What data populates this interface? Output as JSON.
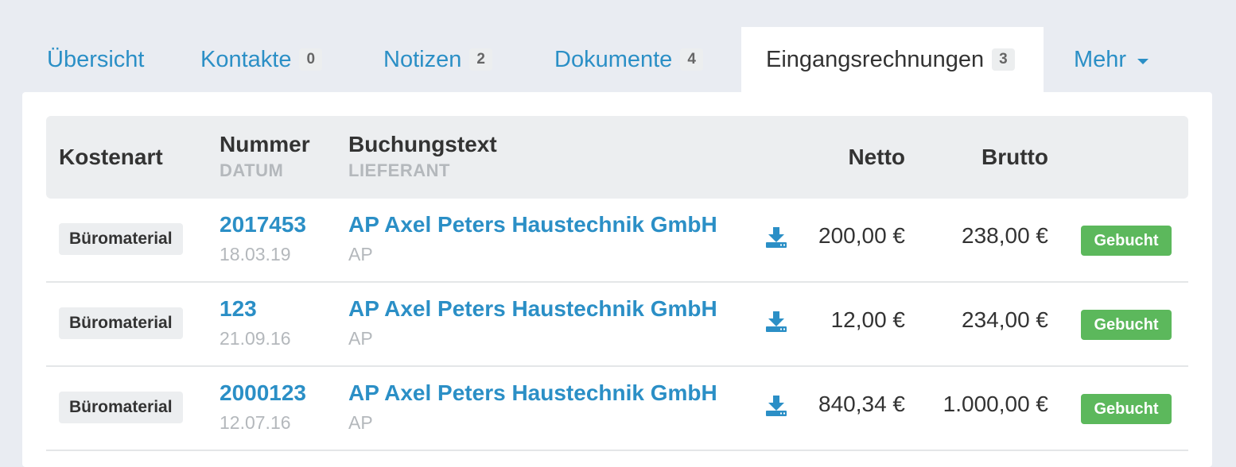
{
  "tabs": [
    {
      "label": "Übersicht",
      "badge": ""
    },
    {
      "label": "Kontakte",
      "badge": "0"
    },
    {
      "label": "Notizen",
      "badge": "2"
    },
    {
      "label": "Dokumente",
      "badge": "4"
    },
    {
      "label": "Eingangsrechnungen",
      "badge": "3",
      "active": true
    },
    {
      "label": "Mehr",
      "badge": ""
    }
  ],
  "table": {
    "headers": {
      "kostenart": "Kostenart",
      "nummer": "Nummer",
      "datum": "DATUM",
      "buchungstext": "Buchungstext",
      "lieferant": "LIEFERANT",
      "netto": "Netto",
      "brutto": "Brutto"
    },
    "rows": [
      {
        "category": "Büromaterial",
        "number": "2017453",
        "date": "18.03.19",
        "text": "AP Axel Peters Haustechnik GmbH",
        "supplier": "AP",
        "netto": "200,00 €",
        "brutto": "238,00 €",
        "status": "Gebucht"
      },
      {
        "category": "Büromaterial",
        "number": "123",
        "date": "21.09.16",
        "text": "AP Axel Peters Haustechnik GmbH",
        "supplier": "AP",
        "netto": "12,00 €",
        "brutto": "234,00 €",
        "status": "Gebucht"
      },
      {
        "category": "Büromaterial",
        "number": "2000123",
        "date": "12.07.16",
        "text": "AP Axel Peters Haustechnik GmbH",
        "supplier": "AP",
        "netto": "840,34 €",
        "brutto": "1.000,00 €",
        "status": "Gebucht"
      }
    ]
  },
  "colors": {
    "accent": "#2b8fc6",
    "status_green": "#5cb85c",
    "page_bg": "#e9ecf2"
  },
  "icons": {
    "download": "download-icon",
    "dropdown": "caret-down-icon"
  }
}
